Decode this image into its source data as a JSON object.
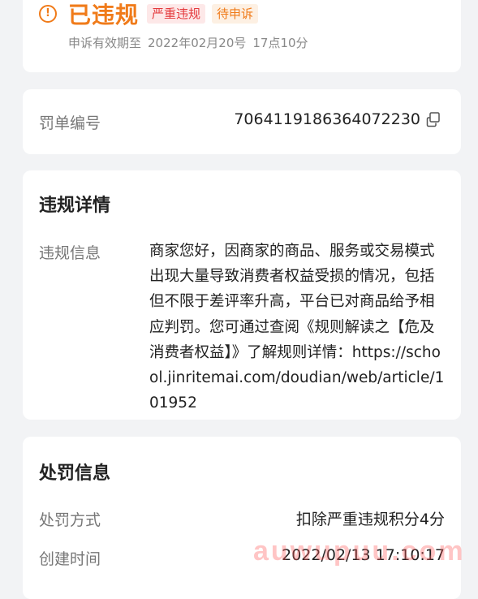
{
  "status": {
    "title": "已违规",
    "badge_severe": "严重违规",
    "badge_pending": "待申诉",
    "deadline_label": "申诉有效期至",
    "deadline_date": "2022年02月20号",
    "deadline_time": "17点10分"
  },
  "order": {
    "label": "罚单编号",
    "value": "7064119186364072230"
  },
  "detail": {
    "title": "违规详情",
    "info_label": "违规信息",
    "info_text": "商家您好，因商家的商品、服务或交易模式出现大量导致消费者权益受损的情况，包括但不限于差评率升高，平台已对商品给予相应判罚。您可通过查阅《规则解读之【危及消费者权益】》了解规则详情：https://school.jinritemai.com/doudian/web/article/101952"
  },
  "punishment": {
    "title": "处罚信息",
    "method_label": "处罚方式",
    "method_value": "扣除严重违规积分4分",
    "created_label": "创建时间",
    "created_value": "2022/02/13 17:10:17"
  },
  "watermark": "auwupuu.com",
  "colors": {
    "warning": "#f07b1a",
    "severe": "#e4393c",
    "background": "#f2f3f5"
  },
  "icons": {
    "status": "warning-circle-icon",
    "copy": "copy-icon"
  }
}
